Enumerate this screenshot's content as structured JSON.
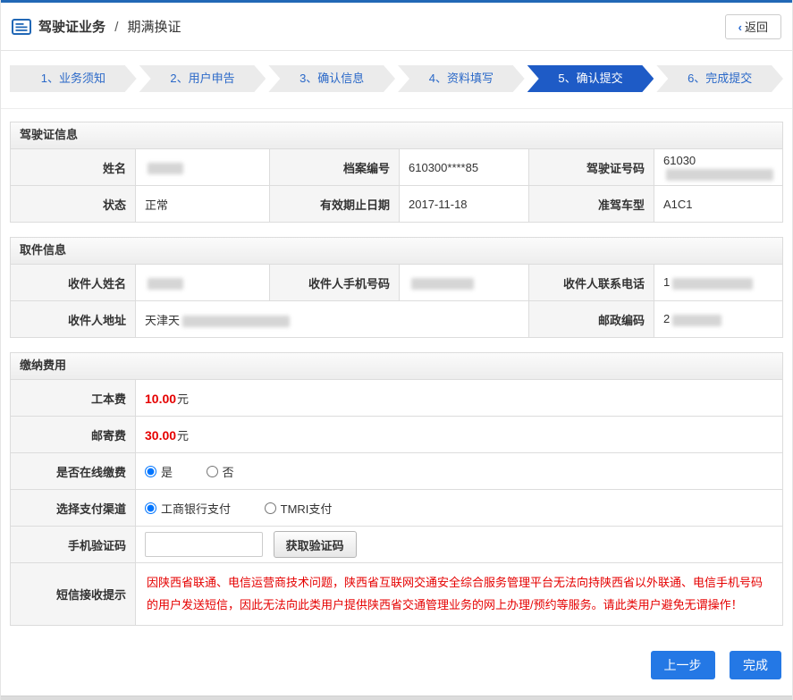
{
  "page": {
    "back_chevron": "‹",
    "back_label": "返回",
    "accent_color": "#2268b6",
    "active_step_color": "#1e5bc6",
    "price_color": "#e50000"
  },
  "header": {
    "title_primary": "驾驶证业务",
    "title_separator": "/",
    "title_secondary": "期满换证"
  },
  "steps": [
    {
      "label": "1、业务须知",
      "active": false
    },
    {
      "label": "2、用户申告",
      "active": false
    },
    {
      "label": "3、确认信息",
      "active": false
    },
    {
      "label": "4、资料填写",
      "active": false
    },
    {
      "label": "5、确认提交",
      "active": true
    },
    {
      "label": "6、完成提交",
      "active": false
    }
  ],
  "sections": {
    "license": {
      "title": "驾驶证信息",
      "rows": [
        {
          "cells": [
            {
              "label": "姓名",
              "value": ""
            },
            {
              "label": "档案编号",
              "value": "610300****85"
            },
            {
              "label": "驾驶证号码",
              "value": "61030"
            }
          ]
        },
        {
          "cells": [
            {
              "label": "状态",
              "value": "正常"
            },
            {
              "label": "有效期止日期",
              "value": "2017-11-18"
            },
            {
              "label": "准驾车型",
              "value": "A1C1"
            }
          ]
        }
      ]
    },
    "pickup": {
      "title": "取件信息",
      "rows": [
        {
          "cells": [
            {
              "label": "收件人姓名",
              "value": ""
            },
            {
              "label": "收件人手机号码",
              "value": ""
            },
            {
              "label": "收件人联系电话",
              "value": "1"
            }
          ]
        },
        {
          "cells": [
            {
              "label": "收件人地址",
              "value": "天津天"
            },
            {
              "label": "邮政编码",
              "value": "2"
            }
          ]
        }
      ]
    },
    "payment": {
      "title": "缴纳费用",
      "work_fee": {
        "label": "工本费",
        "amount": "10.00",
        "unit": "元"
      },
      "mail_fee": {
        "label": "邮寄费",
        "amount": "30.00",
        "unit": "元"
      },
      "online": {
        "label": "是否在线缴费",
        "yes": "是",
        "no": "否"
      },
      "channel": {
        "label": "选择支付渠道",
        "opt1": "工商银行支付",
        "opt2": "TMRI支付"
      },
      "code": {
        "label": "手机验证码",
        "input_value": "",
        "button_label": "获取验证码"
      },
      "sms": {
        "label": "短信接收提示",
        "text": "因陕西省联通、电信运营商技术问题，陕西省互联网交通安全综合服务管理平台无法向持陕西省以外联通、电信手机号码的用户发送短信，因此无法向此类用户提供陕西省交通管理业务的网上办理/预约等服务。请此类用户避免无谓操作！"
      }
    }
  },
  "footer": {
    "prev_label": "上一步",
    "finish_label": "完成"
  }
}
